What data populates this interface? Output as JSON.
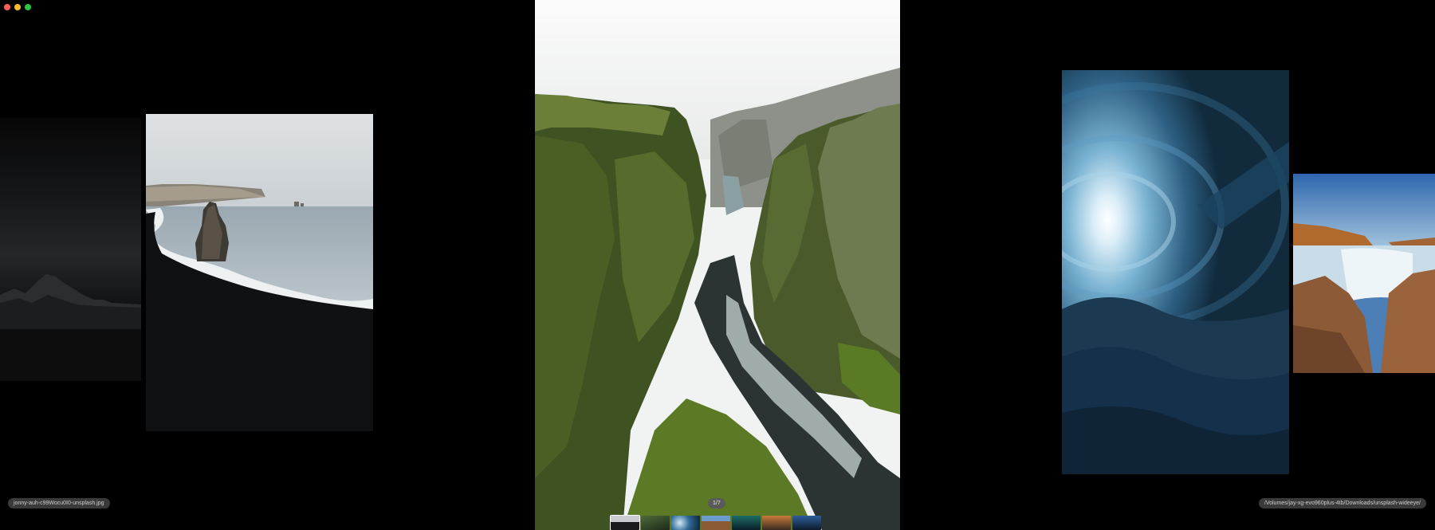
{
  "window": {
    "controls": {
      "close": "close",
      "minimize": "minimize",
      "maximize": "maximize"
    }
  },
  "left_filename": "jonny-auh-c99Wocu0I0-unsplash.jpg",
  "right_filepath": "/Volumes/jay-xg-evo960plus-4tb/Downloads/unsplash-wideeye/",
  "page_counter": "1/7",
  "photos": [
    {
      "name": "misty-mountains",
      "icon": "photo"
    },
    {
      "name": "black-sand-beach-sea-stack",
      "icon": "photo"
    },
    {
      "name": "mossy-canyon-river",
      "icon": "photo"
    },
    {
      "name": "blue-ice-cave",
      "icon": "photo"
    },
    {
      "name": "waterfall-canyon",
      "icon": "photo"
    }
  ],
  "thumbnails": [
    {
      "name": "beach",
      "colors": [
        "#c8ccd0",
        "#1a1b1d"
      ]
    },
    {
      "name": "canyon",
      "colors": [
        "#4e6a3a",
        "#1d2a18"
      ]
    },
    {
      "name": "ice-cave",
      "colors": [
        "#2f6a97",
        "#0f2436"
      ]
    },
    {
      "name": "waterfall",
      "colors": [
        "#6b9ccc",
        "#8a5a35"
      ]
    },
    {
      "name": "aurora",
      "colors": [
        "#1c6d63",
        "#0b1f2a"
      ]
    },
    {
      "name": "orange-cliffs",
      "colors": [
        "#c77b3b",
        "#3a2a22"
      ]
    },
    {
      "name": "blue-mountain",
      "colors": [
        "#2f5e9a",
        "#0e1b2c"
      ]
    }
  ]
}
